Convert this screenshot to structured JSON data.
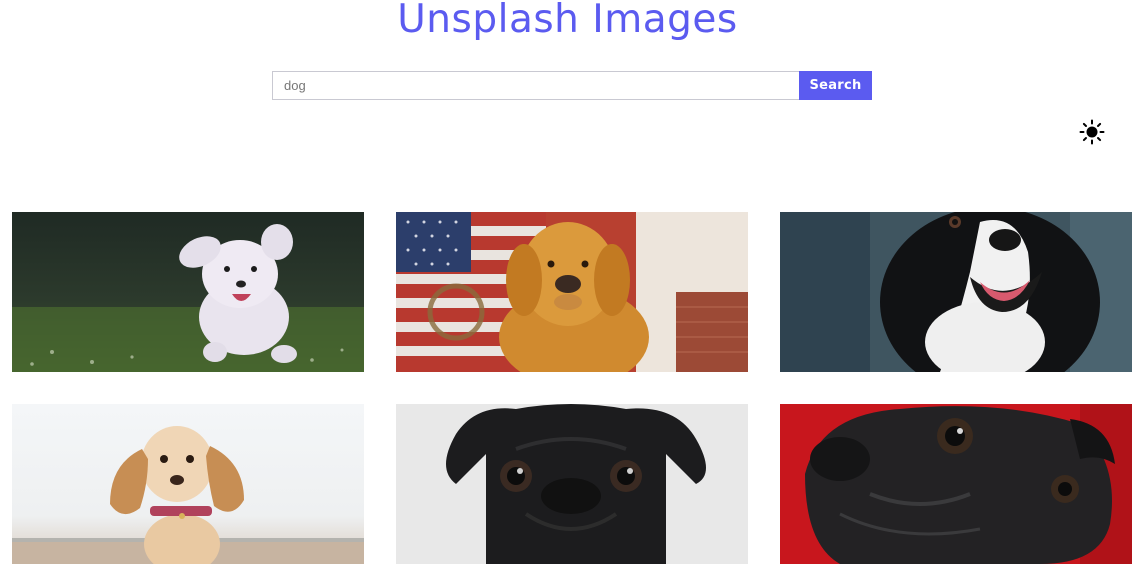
{
  "header": {
    "title": "Unsplash Images"
  },
  "search": {
    "value": "dog",
    "placeholder": "dog",
    "button_label": "Search"
  },
  "theme_toggle": {
    "icon": "sun-icon"
  },
  "images": [
    {
      "subject": "white poodle running on grass",
      "icon": "dog-photo"
    },
    {
      "subject": "golden retriever in front of american flag",
      "icon": "dog-photo"
    },
    {
      "subject": "black and white border collie",
      "icon": "dog-photo"
    },
    {
      "subject": "cocker spaniel puppy on beach",
      "icon": "dog-photo"
    },
    {
      "subject": "black pug on white background",
      "icon": "dog-photo"
    },
    {
      "subject": "black pug on red background",
      "icon": "dog-photo"
    }
  ],
  "colors": {
    "accent": "#5b5bf0",
    "background": "#ffffff"
  }
}
